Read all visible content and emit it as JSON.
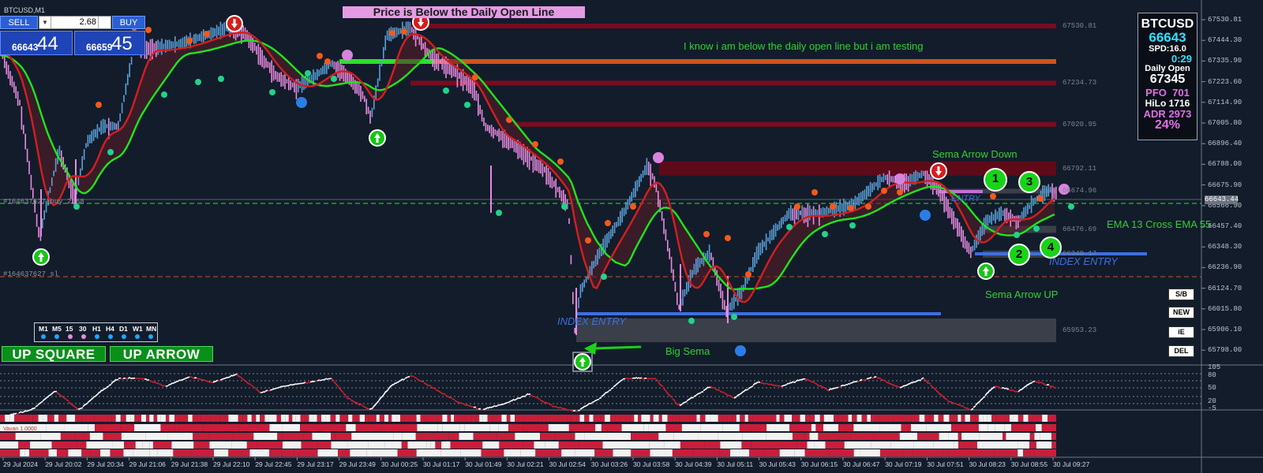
{
  "chart": {
    "symbol_caption": "BTCUSD,M1",
    "price_axis": [
      "67530.81",
      "67444.30",
      "67335.90",
      "67223.60",
      "67114.90",
      "67005.80",
      "66896.40",
      "66788.00",
      "66675.90",
      "66566.90",
      "66457.40",
      "66348.30",
      "66236.90",
      "66124.70",
      "66015.80",
      "65906.10",
      "65798.00"
    ],
    "price_levels": [
      {
        "label": "67530.81",
        "color": "#7a0c1f",
        "price": 67530.81
      },
      {
        "label": "67234.73",
        "color": "#7a0c1f",
        "price": 67234.73
      },
      {
        "label": "67020.95",
        "color": "#7a0c1f",
        "price": 67020.95
      },
      {
        "label": "66792.11",
        "color": "#5e0a18",
        "price": 66792.11
      },
      {
        "label": "66674.96",
        "color": "#3a3f4a",
        "price": 66674.96
      },
      {
        "label": "66476.69",
        "color": "#3a3f4a",
        "price": 66476.69
      },
      {
        "label": "66348.17",
        "color": "#3a3f4a",
        "price": 66348.17
      },
      {
        "label": "65953.23",
        "color": "#3a3f4a",
        "price": 65953.23
      }
    ],
    "current_price_label": "66643.44",
    "order_label_top": "#164637627 buy 2.68",
    "order_label_sl": "#164637627 sl",
    "time_axis": [
      "29 Jul 2024",
      "29 Jul 20:02",
      "29 Jul 20:34",
      "29 Jul 21:06",
      "29 Jul 21:38",
      "29 Jul 22:10",
      "29 Jul 22:45",
      "29 Jul 23:17",
      "29 Jul 23:49",
      "30 Jul 00:25",
      "30 Jul 01:17",
      "30 Jul 01:49",
      "30 Jul 02:21",
      "30 Jul 02:54",
      "30 Jul 03:26",
      "30 Jul 03:58",
      "30 Jul 04:39",
      "30 Jul 05:11",
      "30 Jul 05:43",
      "30 Jul 06:15",
      "30 Jul 06:47",
      "30 Jul 07:19",
      "30 Jul 07:51",
      "30 Jul 08:23",
      "30 Jul 08:55",
      "30 Jul 09:27"
    ],
    "osc_axis": [
      "105",
      "80",
      "50",
      "20",
      "-5"
    ],
    "indicator_label": "Vavan 1.0000"
  },
  "trade_panel": {
    "sell_label": "SELL",
    "buy_label": "BUY",
    "lot_value": "2.68",
    "bid_small": "66643",
    "bid_big": "44",
    "ask_small": "66659",
    "ask_big": "45"
  },
  "info_panel": {
    "symbol": "BTCUSD",
    "price": "66643",
    "spread": "SPD:16.0",
    "timer": "0:29",
    "daily_open_label": "Daily Open",
    "daily_open_value": "67345",
    "pfo_label": "PFO",
    "pfo_value": "701",
    "hilo_label": "HiLo",
    "hilo_value": "1716",
    "adr_label": "ADR",
    "adr_value": "2973",
    "percent": "24%"
  },
  "buttons": {
    "sb": "S/B",
    "new": "NEW",
    "ie": "iE",
    "del": "DEL"
  },
  "timeframes": {
    "labels": [
      "M1",
      "M5",
      "15",
      "30",
      "H1",
      "H4",
      "D1",
      "W1",
      "MN"
    ],
    "colors": [
      "#1ea7ff",
      "#1ea7ff",
      "#e58ae0",
      "#e58ae0",
      "#1ea7ff",
      "#1ea7ff",
      "#1ea7ff",
      "#1ea7ff",
      "#1ea7ff"
    ]
  },
  "signals": {
    "up_square": "UP SQUARE",
    "up_arrow": "UP ARROW"
  },
  "annotations": {
    "banner": "Price is Below the Daily Open Line",
    "testing_note": "I know i am below the daily open line but i am testing",
    "sema_down": "Sema Arrow Down",
    "sema_up": "Sema Arrow UP",
    "ema_cross": "EMA 13 Cross EMA 55",
    "big_sema": "Big Sema",
    "index_entry_1": "INDEX ENTRY",
    "index_entry_2": "INDEX ENTRY",
    "entry": "ENTRY",
    "circle_1": "1",
    "circle_2": "2",
    "circle_3": "3",
    "circle_4": "4"
  },
  "colors": {
    "background": "#131c2b",
    "ema_fast": "#d21f1f",
    "ema_slow": "#1ee61e",
    "candle_bear": "#e88ae0",
    "candle_bull": "#5aa0d8",
    "daily_open": "#d2521b",
    "index_entry_line": "#3d6fe0"
  }
}
